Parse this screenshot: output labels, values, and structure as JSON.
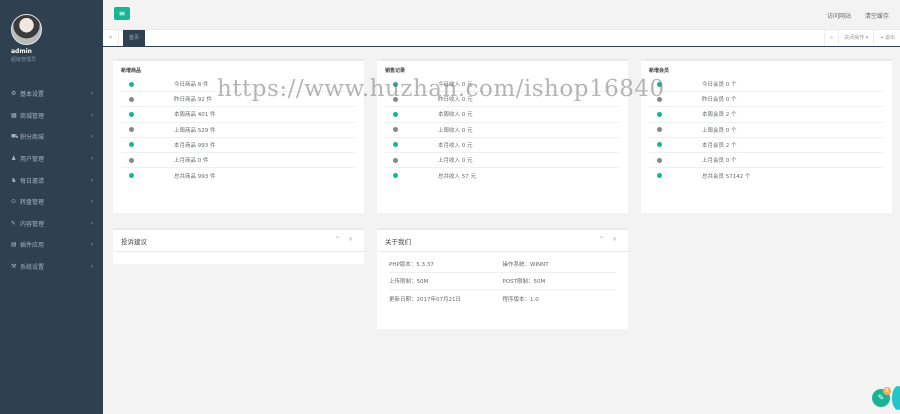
{
  "sidebar": {
    "user": {
      "name": "admin",
      "role": "超级管理员"
    },
    "items": [
      {
        "icon": "⚙",
        "label": "基本设置"
      },
      {
        "icon": "▦",
        "label": "商城管理"
      },
      {
        "icon": "⛟",
        "label": "积分商城"
      },
      {
        "icon": "♟",
        "label": "用户管理"
      },
      {
        "icon": "♞",
        "label": "每日邀请"
      },
      {
        "icon": "⊙",
        "label": "转盘管理"
      },
      {
        "icon": "✎",
        "label": "内容管理"
      },
      {
        "icon": "▤",
        "label": "插件应用"
      },
      {
        "icon": "⚒",
        "label": "系统设置"
      }
    ],
    "arrow": "‹"
  },
  "topbar": {
    "menu_icon": "≡",
    "visit_site": "访问网站",
    "clear_cache": "清空缓存"
  },
  "tabs": {
    "prev": "«",
    "active": "首页",
    "next": "»",
    "close_ops": "关闭操作 ▾",
    "logout": "⇥ 退出"
  },
  "cards": {
    "goods": {
      "title": "新增商品",
      "rows": [
        {
          "text": "今日商品 8 件",
          "color": "#1ab394"
        },
        {
          "text": "昨日商品 92 件",
          "color": "#888888"
        },
        {
          "text": "本周商品 401 件",
          "color": "#1ab394"
        },
        {
          "text": "上周商品 529 件",
          "color": "#888888"
        },
        {
          "text": "本月商品 993 件",
          "color": "#1ab394"
        },
        {
          "text": "上月商品 0 件",
          "color": "#888888"
        },
        {
          "text": "总共商品 993 件",
          "color": "#1ab394"
        }
      ]
    },
    "orders": {
      "title": "销售记录",
      "rows": [
        {
          "text": "今日收入 0 元",
          "color": "#1ab394"
        },
        {
          "text": "昨日收入 0 元",
          "color": "#888888"
        },
        {
          "text": "本周收入 0 元",
          "color": "#1ab394"
        },
        {
          "text": "上周收入 0 元",
          "color": "#888888"
        },
        {
          "text": "本月收入 0 元",
          "color": "#1ab394"
        },
        {
          "text": "上月收入 0 元",
          "color": "#888888"
        },
        {
          "text": "总共收入 57 元",
          "color": "#1ab394"
        }
      ]
    },
    "members": {
      "title": "新增会员",
      "rows": [
        {
          "text": "今日会员 0 个",
          "color": "#1ab394"
        },
        {
          "text": "昨日会员 0 个",
          "color": "#888888"
        },
        {
          "text": "本周会员 2 个",
          "color": "#1ab394"
        },
        {
          "text": "上周会员 0 个",
          "color": "#888888"
        },
        {
          "text": "本月会员 2 个",
          "color": "#1ab394"
        },
        {
          "text": "上月会员 0 个",
          "color": "#888888"
        },
        {
          "text": "总共会员 57142 个",
          "color": "#1ab394"
        }
      ]
    },
    "feedback": {
      "title": "投诉建议",
      "tools": "^ ×"
    },
    "about": {
      "title": "关于我们",
      "tools": "^ ×",
      "rows": [
        [
          "PHP版本：5.3.37",
          "操作系统：WINNT"
        ],
        [
          "上传限制：50M",
          "POST限制：50M"
        ],
        [
          "更新日期：2017年07月21日",
          "程序版本：1.0"
        ]
      ]
    }
  },
  "watermark": "https://www.huzhan.com/ishop16840",
  "float": {
    "icon": "✎",
    "badge": "8"
  }
}
